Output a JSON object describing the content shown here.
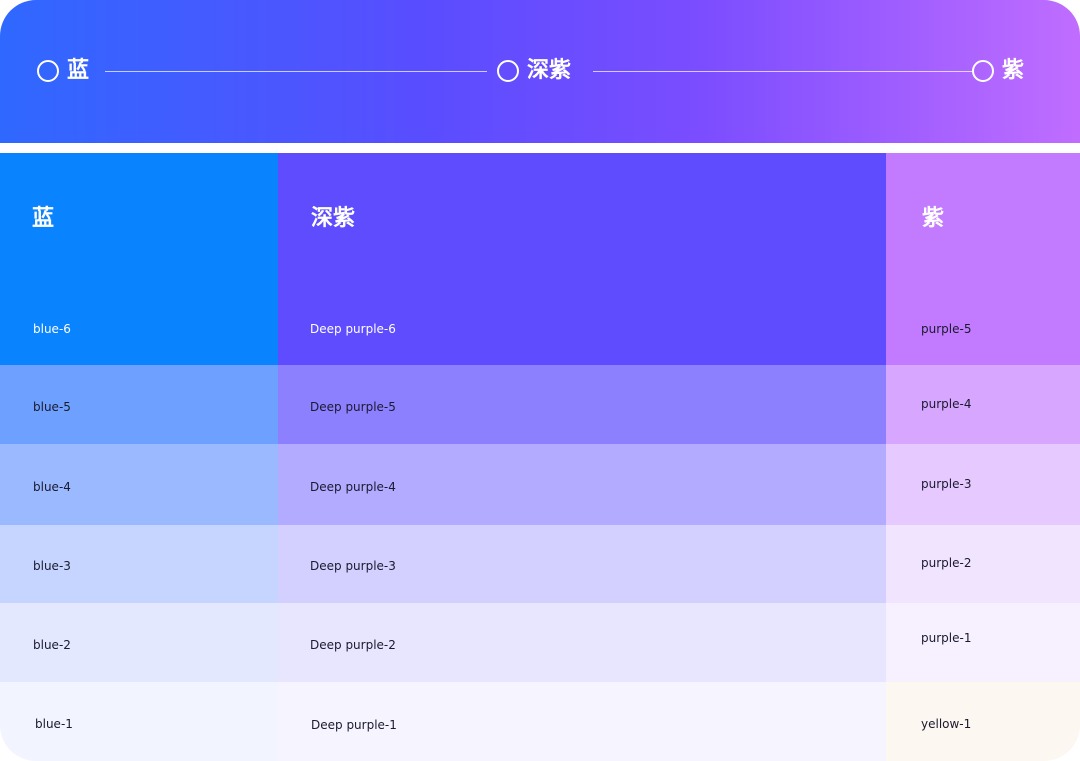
{
  "header": {
    "steps": [
      {
        "label": "蓝"
      },
      {
        "label": "深紫"
      },
      {
        "label": "紫"
      }
    ]
  },
  "columns": [
    {
      "title": "蓝",
      "swatches": [
        {
          "name": "blue-6",
          "color": "#0a83ff"
        },
        {
          "name": "blue-5",
          "color": "#6ea1ff"
        },
        {
          "name": "blue-4",
          "color": "#9ab9ff"
        },
        {
          "name": "blue-3",
          "color": "#c6d5ff"
        },
        {
          "name": "blue-2",
          "color": "#e3e8ff"
        },
        {
          "name": "blue-1",
          "color": "#f2f4ff"
        }
      ]
    },
    {
      "title": "深紫",
      "swatches": [
        {
          "name": "Deep purple-6",
          "color": "#5f4cff"
        },
        {
          "name": "Deep purple-5",
          "color": "#8d80ff"
        },
        {
          "name": "Deep purple-4",
          "color": "#b3abff"
        },
        {
          "name": "Deep purple-3",
          "color": "#d3cfff"
        },
        {
          "name": "Deep purple-2",
          "color": "#e8e6ff"
        },
        {
          "name": "Deep purple-1",
          "color": "#f5f4ff"
        }
      ]
    },
    {
      "title": "紫",
      "swatches": [
        {
          "name": "purple-5",
          "color": "#c27aff"
        },
        {
          "name": "purple-4",
          "color": "#d7a6ff"
        },
        {
          "name": "purple-3",
          "color": "#e6caff"
        },
        {
          "name": "purple-2",
          "color": "#f1e4ff"
        },
        {
          "name": "purple-1",
          "color": "#f7f1ff"
        },
        {
          "name": "yellow-1",
          "color": "#fdf7f1"
        }
      ]
    }
  ]
}
